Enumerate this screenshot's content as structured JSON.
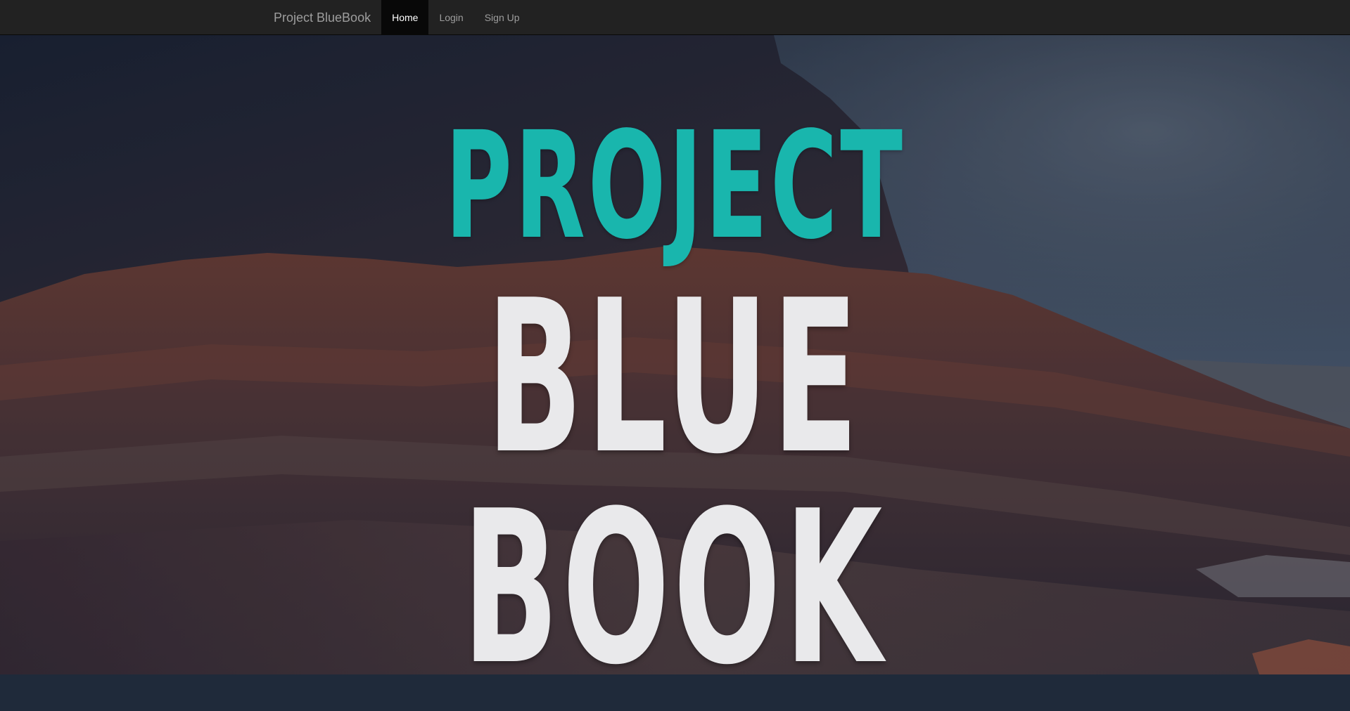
{
  "navbar": {
    "brand": "Project BlueBook",
    "links": [
      {
        "label": "Home",
        "active": true
      },
      {
        "label": "Login",
        "active": false
      },
      {
        "label": "Sign Up",
        "active": false
      }
    ]
  },
  "hero": {
    "title_line1": "PROJECT",
    "title_line2": "BLUE BOOK"
  },
  "colors": {
    "navbar_bg": "#222222",
    "active_link_bg": "#080808",
    "title_line1": "#19b6ad",
    "title_line2": "#e9e9eb"
  }
}
